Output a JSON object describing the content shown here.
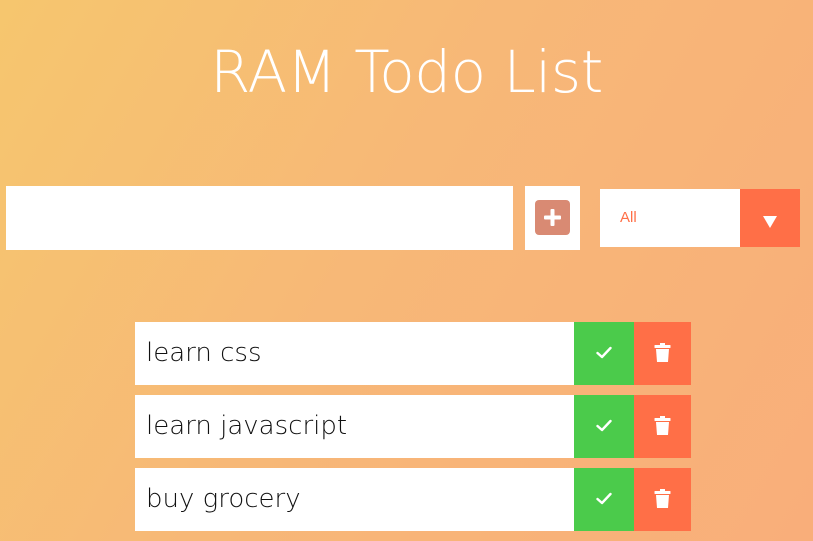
{
  "header": {
    "title": "RAM Todo List"
  },
  "form": {
    "input_value": "",
    "add_icon": "plus-icon",
    "filter_selected": "All",
    "filter_icon": "caret-down-icon"
  },
  "todos": [
    {
      "text": "learn css",
      "check_icon": "check-icon",
      "delete_icon": "trash-icon"
    },
    {
      "text": "learn javascript",
      "check_icon": "check-icon",
      "delete_icon": "trash-icon"
    },
    {
      "text": "buy grocery",
      "check_icon": "check-icon",
      "delete_icon": "trash-icon"
    }
  ],
  "colors": {
    "accent": "#ff6f47",
    "complete": "#4bcb4b",
    "add_button": "#d98a73",
    "text_white": "#ffffff"
  }
}
